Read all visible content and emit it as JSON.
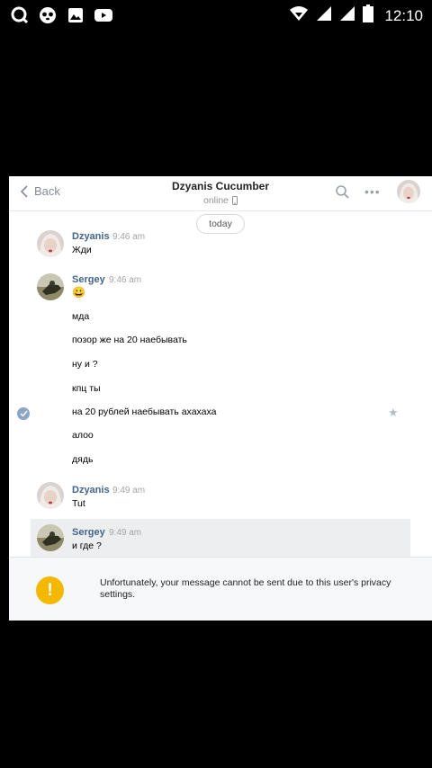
{
  "statusbar": {
    "time": "12:10"
  },
  "header": {
    "back_label": "Back",
    "title": "Dzyanis Cucumber",
    "status": "online"
  },
  "date_divider": "today",
  "messages": [
    {
      "sender": "Dzyanis",
      "time": "9:46 am",
      "lines": [
        "Жди"
      ]
    },
    {
      "sender": "Sergey",
      "time": "9:46 am",
      "lines": [
        "😀",
        "мда",
        "позор же на 20 наебывать",
        "ну и ?",
        "кпц ты",
        "на 20 рублей наебывать ахахаха",
        "алоо",
        "дядь"
      ]
    },
    {
      "sender": "Dzyanis",
      "time": "9:49 am",
      "lines": [
        "Tut"
      ]
    },
    {
      "sender": "Sergey",
      "time": "9:49 am",
      "lines": [
        "и где ?"
      ]
    }
  ],
  "notice": {
    "icon": "!",
    "text": "Unfortunately, your message cannot be sent due to this user's privacy settings."
  },
  "colors": {
    "accent": "#42648b",
    "warning": "#f5b800"
  }
}
